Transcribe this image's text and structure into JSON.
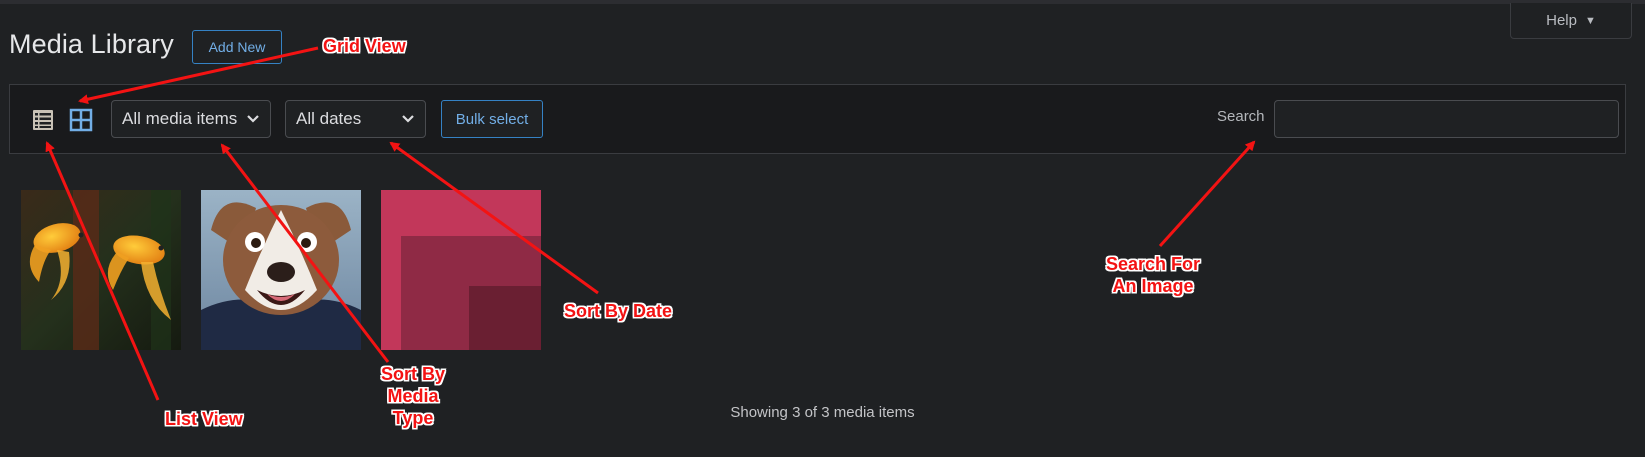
{
  "page": {
    "title": "Media Library",
    "add_new_label": "Add New",
    "help_label": "Help",
    "help_caret": "▼"
  },
  "toolbar": {
    "list_view_icon": "list-view-icon",
    "grid_view_icon": "grid-view-icon",
    "active_view": "grid",
    "media_type_filter": {
      "selected": "All media items"
    },
    "date_filter": {
      "selected": "All dates"
    },
    "bulk_select_label": "Bulk select",
    "search_label": "Search",
    "search_value": ""
  },
  "media_items": [
    {
      "name": "goldfish-image"
    },
    {
      "name": "dog-image"
    },
    {
      "name": "red-squares-image"
    }
  ],
  "status": {
    "showing_text": "Showing 3 of 3 media items"
  },
  "annotations": {
    "grid_view": "Grid View",
    "list_view": "List View",
    "sort_media_line1": "Sort By",
    "sort_media_line2": "Media",
    "sort_media_line3": "Type",
    "sort_date": "Sort By Date",
    "search_line1": "Search For",
    "search_line2": "An Image"
  },
  "colors": {
    "background": "#1f2123",
    "toolbar_bg": "#191a1c",
    "accent_blue": "#72aee6",
    "annotation_red": "#f31313"
  }
}
